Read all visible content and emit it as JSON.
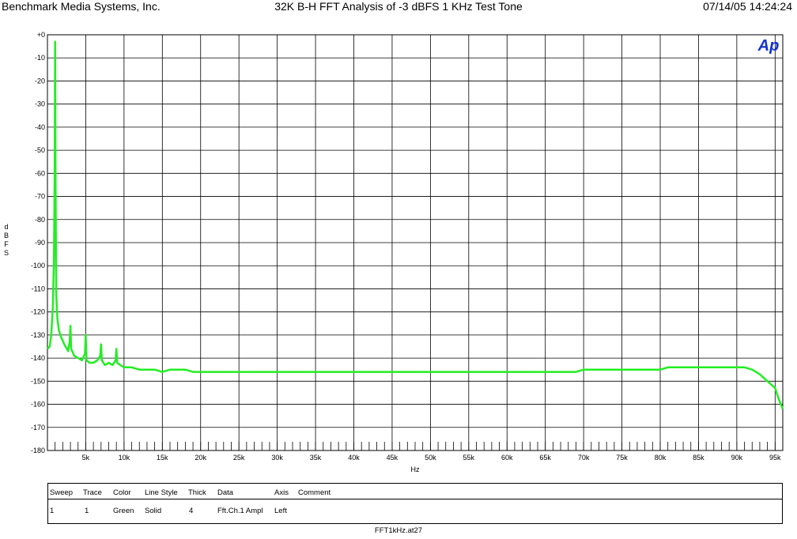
{
  "header": {
    "left": "Benchmark Media Systems, Inc.",
    "center": "32K B-H FFT Analysis of -3 dBFS 1 KHz Test Tone",
    "right": "07/14/05 14:24:24"
  },
  "logo_text": "Ap",
  "colors": {
    "trace": "#22ee22",
    "logo": "#1133cc",
    "grid": "#000000"
  },
  "chart_data": {
    "type": "line",
    "title": "32K B-H FFT Analysis of -3 dBFS 1 KHz Test Tone",
    "xlabel": "Hz",
    "ylabel": "dBFS",
    "xlim": [
      0,
      96000
    ],
    "ylim": [
      -180,
      0
    ],
    "grid": true,
    "x_ticks": [
      5000,
      10000,
      15000,
      20000,
      25000,
      30000,
      35000,
      40000,
      45000,
      50000,
      55000,
      60000,
      65000,
      70000,
      75000,
      80000,
      85000,
      90000,
      95000
    ],
    "x_tick_labels": [
      "5k",
      "10k",
      "15k",
      "20k",
      "25k",
      "30k",
      "35k",
      "40k",
      "45k",
      "50k",
      "55k",
      "60k",
      "65k",
      "70k",
      "75k",
      "80k",
      "85k",
      "90k",
      "95k"
    ],
    "y_ticks": [
      0,
      -10,
      -20,
      -30,
      -40,
      -50,
      -60,
      -70,
      -80,
      -90,
      -100,
      -110,
      -120,
      -130,
      -140,
      -150,
      -160,
      -170,
      -180
    ],
    "y_tick_labels": [
      "+0",
      "-10",
      "-20",
      "-30",
      "-40",
      "-50",
      "-60",
      "-70",
      "-80",
      "-90",
      "-100",
      "-110",
      "-120",
      "-130",
      "-140",
      "-150",
      "-160",
      "-170",
      "-180"
    ],
    "series": [
      {
        "x": [
          0,
          300,
          500,
          700,
          850,
          950,
          1000,
          1050,
          1150,
          1300,
          1500,
          1800,
          2200,
          2700,
          2900,
          3000,
          3100,
          3500,
          4000,
          4500,
          4900,
          5000,
          5100,
          5500,
          6000,
          6500,
          6900,
          7000,
          7100,
          7500,
          8000,
          8500,
          8900,
          9000,
          9100,
          9500,
          10000,
          11000,
          12000,
          13000,
          14000,
          15000,
          16000,
          17000,
          18000,
          19000,
          20000,
          21000,
          22000,
          23000,
          24000,
          25000,
          26000,
          27000,
          28000,
          29000,
          30000,
          31000,
          32000,
          33000,
          34000,
          35000,
          36000,
          37000,
          38000,
          39000,
          40000,
          41000,
          42000,
          43000,
          44000,
          45000,
          46000,
          47000,
          48000,
          49000,
          50000,
          51000,
          52000,
          53000,
          54000,
          55000,
          56000,
          57000,
          58000,
          59000,
          60000,
          61000,
          62000,
          63000,
          64000,
          65000,
          66000,
          67000,
          68000,
          69000,
          70000,
          71000,
          72000,
          73000,
          74000,
          75000,
          76000,
          77000,
          78000,
          79000,
          80000,
          81000,
          82000,
          83000,
          84000,
          85000,
          86000,
          87000,
          88000,
          89000,
          90000,
          91000,
          92000,
          93000,
          94000,
          95000,
          95500,
          96000
        ],
        "y": [
          -136,
          -135,
          -130,
          -118,
          -98,
          -60,
          -3,
          -60,
          -112,
          -123,
          -128,
          -131,
          -134,
          -137,
          -133,
          -126,
          -136,
          -139,
          -140,
          -141,
          -138,
          -130,
          -141,
          -142,
          -142,
          -141,
          -139,
          -134,
          -141,
          -143,
          -142,
          -143,
          -141,
          -136,
          -142,
          -143,
          -144,
          -144,
          -145,
          -145,
          -145,
          -146,
          -145,
          -145,
          -145,
          -146,
          -146,
          -146,
          -146,
          -146,
          -146,
          -146,
          -146,
          -146,
          -146,
          -146,
          -146,
          -146,
          -146,
          -146,
          -146,
          -146,
          -146,
          -146,
          -146,
          -146,
          -146,
          -146,
          -146,
          -146,
          -146,
          -146,
          -146,
          -146,
          -146,
          -146,
          -146,
          -146,
          -146,
          -146,
          -146,
          -146,
          -146,
          -146,
          -146,
          -146,
          -146,
          -146,
          -146,
          -146,
          -146,
          -146,
          -146,
          -146,
          -146,
          -146,
          -145,
          -145,
          -145,
          -145,
          -145,
          -145,
          -145,
          -145,
          -145,
          -145,
          -145,
          -144,
          -144,
          -144,
          -144,
          -144,
          -144,
          -144,
          -144,
          -144,
          -144,
          -144,
          -145,
          -147,
          -150,
          -153,
          -158,
          -162
        ]
      }
    ]
  },
  "legend": {
    "headers": [
      "Sweep",
      "Trace",
      "Color",
      "Line Style",
      "Thick",
      "Data",
      "Axis",
      "Comment"
    ],
    "row": [
      "1",
      "1",
      "Green",
      "Solid",
      "4",
      "Fft.Ch.1 Ampl",
      "Left",
      ""
    ]
  },
  "footer": "FFT1kHz.at27"
}
